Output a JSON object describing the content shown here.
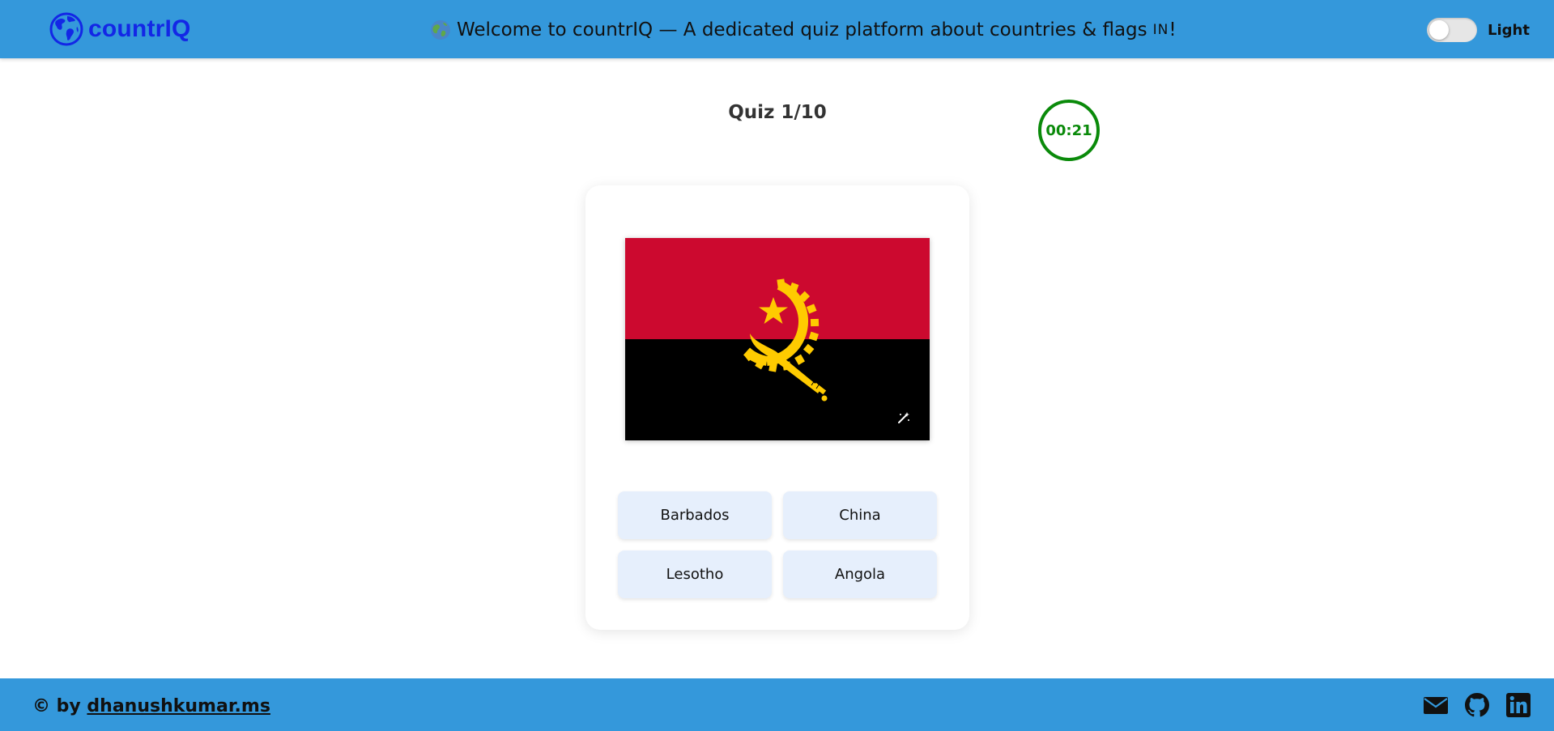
{
  "header": {
    "brand": "countrIQ",
    "welcome_text": "Welcome to countrIQ — A dedicated quiz platform about countries & flags",
    "welcome_suffix": "IN",
    "welcome_end": "!",
    "theme_label": "Light",
    "theme_dark_mode": false
  },
  "quiz": {
    "title": "Quiz 1/10",
    "timer": "00:21",
    "flag_icon": "flag-of-angola",
    "options": [
      "Barbados",
      "China",
      "Lesotho",
      "Angola"
    ]
  },
  "footer": {
    "copyright": "© by",
    "author": "dhanushkumar.ms",
    "social_icons": [
      "mail-icon",
      "github-icon",
      "linkedin-icon"
    ]
  },
  "colors": {
    "header_bg": "#3498db",
    "brand": "#1327e6",
    "timer": "#0a8a0a",
    "option_bg": "#e6effc",
    "flag_red": "#cc092f",
    "flag_black": "#000000",
    "flag_yellow": "#ffcb00"
  }
}
